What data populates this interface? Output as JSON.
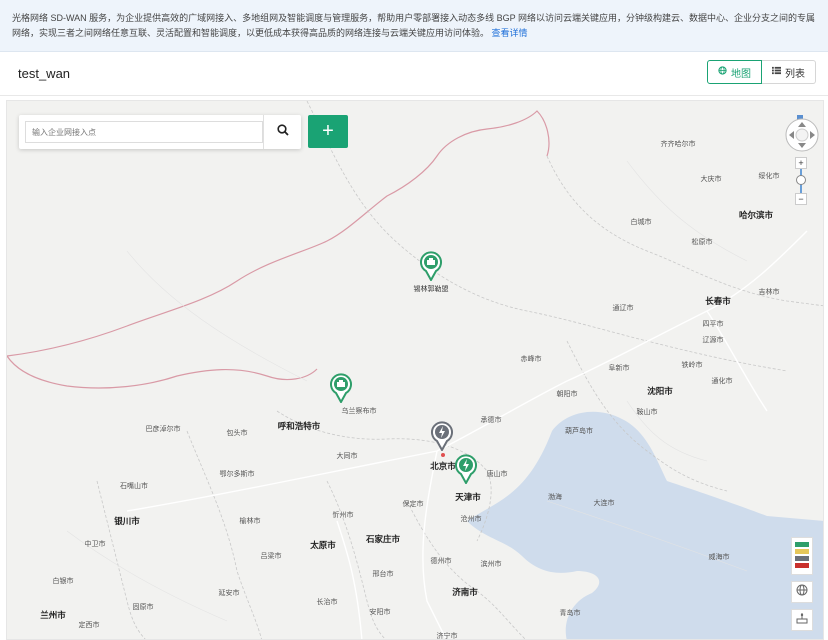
{
  "notice": {
    "text": "光格网络 SD-WAN 服务，为企业提供高效的广域网接入、多地组网及智能调度与管理服务，帮助用户零部署接入动态多线 BGP 网络以访问云端关键应用，分钟级构建云、数据中心、企业分支之间的专属网络，实现三者之间网络任意互联、灵活配置和智能调度，以更低成本获得高品质的网络连接与云端关键应用访问体验。",
    "link": "查看详情"
  },
  "header": {
    "title": "test_wan",
    "map_label": "地图",
    "list_label": "列表"
  },
  "search": {
    "placeholder": "输入企业网接入点"
  },
  "add_label": "+",
  "colors": {
    "accent": "#1aa374",
    "status_green": "#2e9e6a",
    "status_yellow": "#e6c75a",
    "status_gray": "#6b7079",
    "status_red": "#c9302c"
  },
  "markers": [
    {
      "label": "锡林郭勒盟",
      "icon": "building-icon",
      "status": "green"
    },
    {
      "label": "",
      "icon": "building-icon",
      "status": "green"
    },
    {
      "label": "",
      "icon": "lightning-icon",
      "status": "gray"
    },
    {
      "label": "",
      "icon": "lightning-icon",
      "status": "green"
    }
  ],
  "cities": {
    "qiqihaer": "齐齐哈尔市",
    "daqing": "大庆市",
    "suihua": "绥化市",
    "baicheng": "白城市",
    "haerbin": "哈尔滨市",
    "songyuan": "松原市",
    "changchun": "长春市",
    "jilin": "吉林市",
    "siping": "四平市",
    "tongliao": "通辽市",
    "liaoyuan": "辽源市",
    "chifeng": "赤峰市",
    "fuxin": "阜新市",
    "tieling": "铁岭市",
    "shenyang": "沈阳市",
    "tonghua": "通化市",
    "chaoyang": "朝阳市",
    "anshan": "鞍山市",
    "huludao": "葫芦岛市",
    "chengde": "承德市",
    "wulanchabu": "乌兰察布市",
    "hohhot": "呼和浩特市",
    "baotou": "包头市",
    "bayannaoer": "巴彦淖尔市",
    "datong": "大同市",
    "beijing": "北京市",
    "tianjin": "天津市",
    "tangshan": "唐山市",
    "eerduosi": "鄂尔多斯市",
    "shizuishan": "石嘴山市",
    "yinchuan": "银川市",
    "yulin": "榆林市",
    "xinzhou": "忻州市",
    "baoding": "保定市",
    "cangzhou": "沧州市",
    "dalian": "大连市",
    "taiyuan": "太原市",
    "shijiazhuang": "石家庄市",
    "lvliang": "吕梁市",
    "xingtai": "邢台市",
    "dezhou": "德州市",
    "binzhou": "滨州市",
    "weihai": "威海市",
    "zhongwei": "中卫市",
    "baiyin": "白银市",
    "guyuan": "固原市",
    "yanan": "延安市",
    "changzhi": "长治市",
    "anyang": "安阳市",
    "jinan": "济南市",
    "qingdao": "青岛市",
    "lanzhou": "兰州市",
    "dingxi": "定西市",
    "jinan2": "济宁市",
    "bohai": "渤海"
  }
}
